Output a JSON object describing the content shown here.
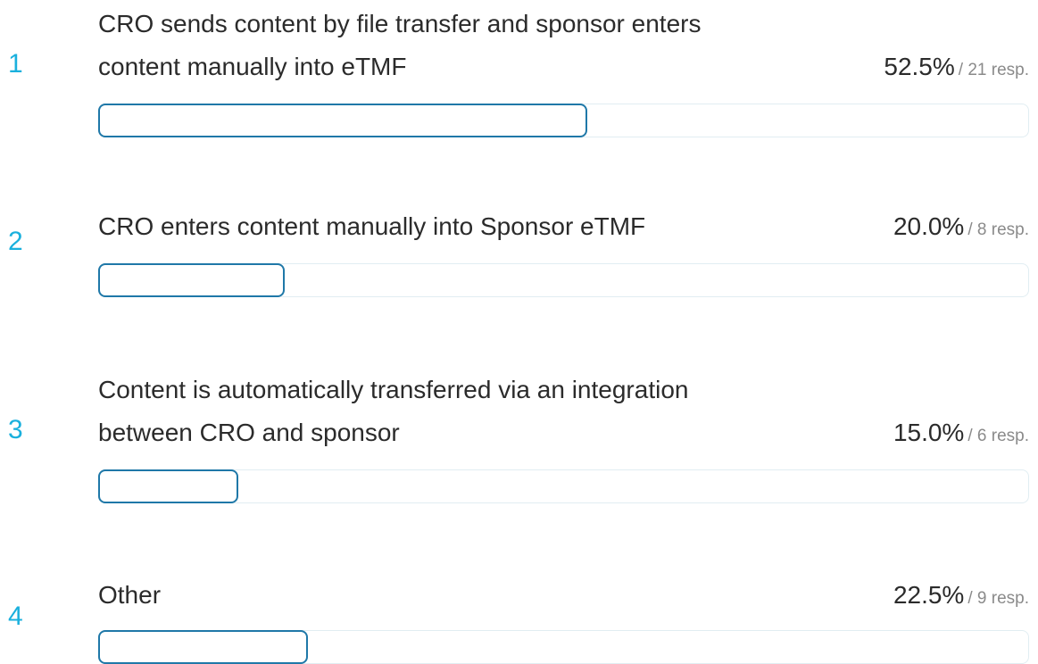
{
  "chart_data": {
    "type": "bar",
    "orientation": "horizontal",
    "categories": [
      "CRO sends content by file transfer and sponsor enters content manually into eTMF",
      "CRO enters content manually into Sponsor eTMF",
      "Content is automatically transferred via an integration between CRO and sponsor",
      "Other"
    ],
    "series": [
      {
        "values": [
          52.5,
          20.0,
          15.0,
          22.5
        ]
      }
    ],
    "responses": [
      21,
      8,
      6,
      9
    ],
    "ylim": [
      0,
      100
    ]
  },
  "rows": [
    {
      "index": "1",
      "label_line1": "CRO sends content by file transfer and sponsor enters",
      "label_line2": "content manually into eTMF",
      "percent": "52.5%",
      "responses": "/ 21 resp."
    },
    {
      "index": "2",
      "label_line1": "CRO enters content manually into Sponsor eTMF",
      "label_line2": "",
      "percent": "20.0%",
      "responses": "/ 8 resp."
    },
    {
      "index": "3",
      "label_line1": "Content is automatically transferred via an integration",
      "label_line2": "between CRO and sponsor",
      "percent": "15.0%",
      "responses": "/ 6 resp."
    },
    {
      "index": "4",
      "label_line1": "Other",
      "label_line2": "",
      "percent": "22.5%",
      "responses": "/ 9 resp."
    }
  ],
  "colors": {
    "index": "#1ab0dd",
    "bar_border": "#1f78a8",
    "track_border": "#e1edf2"
  }
}
